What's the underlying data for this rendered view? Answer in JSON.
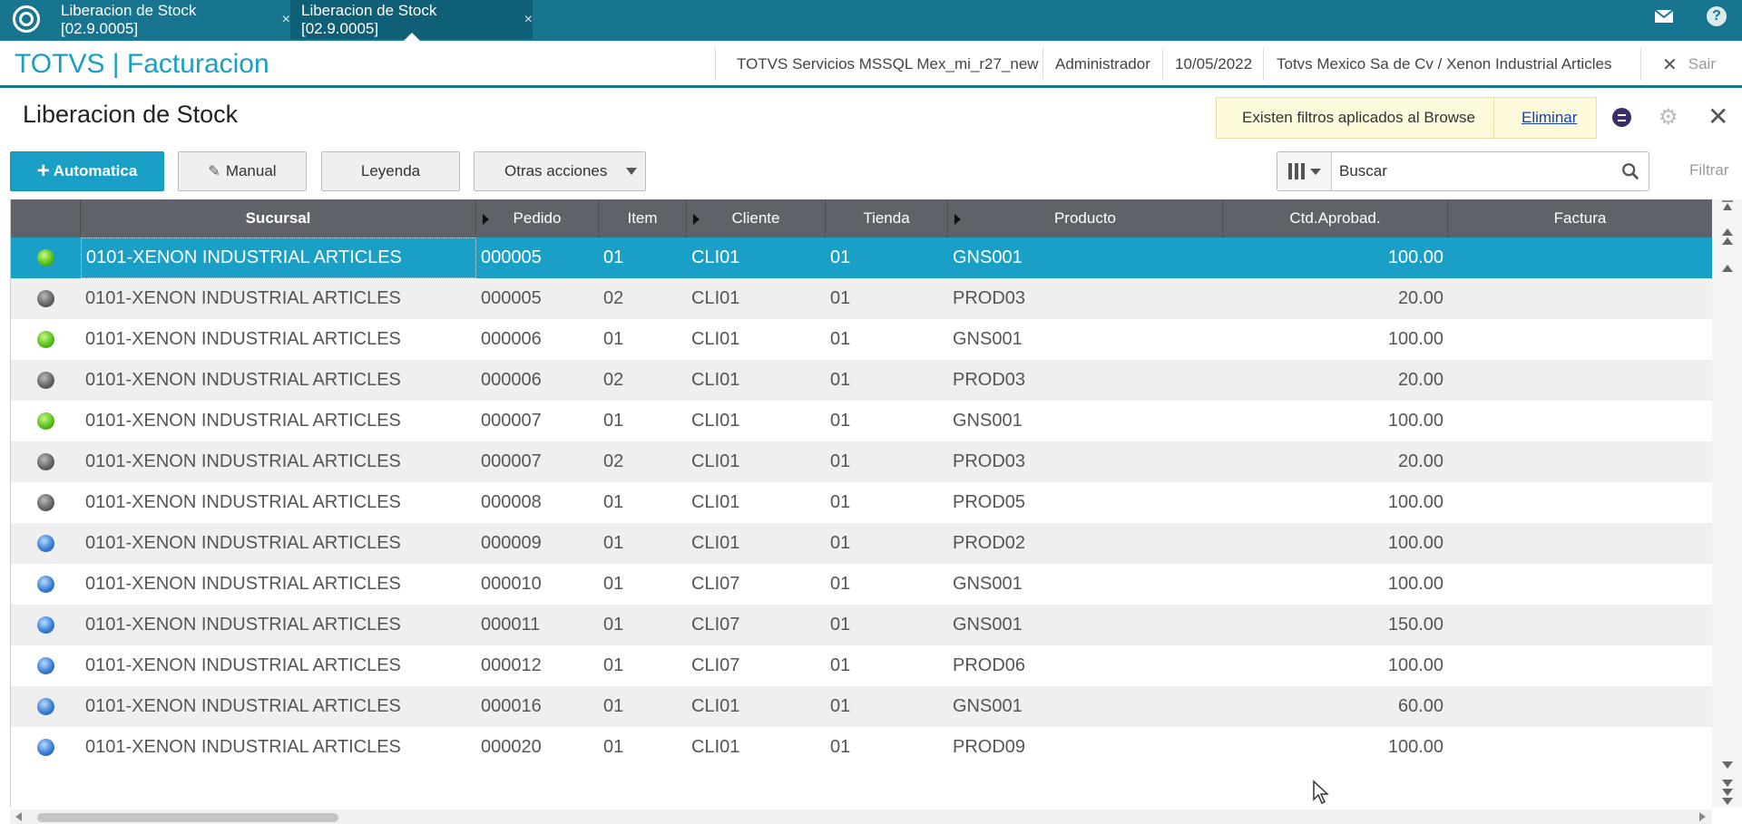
{
  "topbar": {
    "tabs": [
      {
        "label": "Liberacion de Stock [02.9.0005]",
        "close": "×"
      },
      {
        "label": "Liberacion de Stock [02.9.0005]",
        "close": "×"
      }
    ],
    "mail_icon": "mail-icon",
    "help_icon": "help-icon",
    "help_glyph": "?"
  },
  "header": {
    "app_title": "TOTVS | Facturacion",
    "environment": "TOTVS Servicios MSSQL Mex_mi_r27_new",
    "user": "Administrador",
    "date": "10/05/2022",
    "company": "Totvs Mexico Sa de Cv / Xenon Industrial Articles",
    "exit_label": "Sair"
  },
  "page": {
    "title": "Liberacion de Stock",
    "filter_notice": "Existen filtros aplicados al Browse",
    "filter_remove": "Eliminar"
  },
  "toolbar": {
    "automatica": "Automatica",
    "manual": "Manual",
    "leyenda": "Leyenda",
    "otras": "Otras acciones"
  },
  "search": {
    "placeholder": "Buscar",
    "filter_label": "Filtrar"
  },
  "grid": {
    "columns": [
      "",
      "Sucursal",
      "Pedido",
      "Item",
      "Cliente",
      "Tienda",
      "Producto",
      "Ctd.Aprobad.",
      "Factura"
    ],
    "rows": [
      {
        "status": "green",
        "sucursal": "0101-XENON INDUSTRIAL ARTICLES",
        "pedido": "000005",
        "item": "01",
        "cliente": "CLI01",
        "tienda": "01",
        "producto": "GNS001",
        "cantidad": "100.00",
        "factura": ""
      },
      {
        "status": "grey",
        "sucursal": "0101-XENON INDUSTRIAL ARTICLES",
        "pedido": "000005",
        "item": "02",
        "cliente": "CLI01",
        "tienda": "01",
        "producto": "PROD03",
        "cantidad": "20.00",
        "factura": ""
      },
      {
        "status": "green",
        "sucursal": "0101-XENON INDUSTRIAL ARTICLES",
        "pedido": "000006",
        "item": "01",
        "cliente": "CLI01",
        "tienda": "01",
        "producto": "GNS001",
        "cantidad": "100.00",
        "factura": ""
      },
      {
        "status": "grey",
        "sucursal": "0101-XENON INDUSTRIAL ARTICLES",
        "pedido": "000006",
        "item": "02",
        "cliente": "CLI01",
        "tienda": "01",
        "producto": "PROD03",
        "cantidad": "20.00",
        "factura": ""
      },
      {
        "status": "green",
        "sucursal": "0101-XENON INDUSTRIAL ARTICLES",
        "pedido": "000007",
        "item": "01",
        "cliente": "CLI01",
        "tienda": "01",
        "producto": "GNS001",
        "cantidad": "100.00",
        "factura": ""
      },
      {
        "status": "grey",
        "sucursal": "0101-XENON INDUSTRIAL ARTICLES",
        "pedido": "000007",
        "item": "02",
        "cliente": "CLI01",
        "tienda": "01",
        "producto": "PROD03",
        "cantidad": "20.00",
        "factura": ""
      },
      {
        "status": "grey",
        "sucursal": "0101-XENON INDUSTRIAL ARTICLES",
        "pedido": "000008",
        "item": "01",
        "cliente": "CLI01",
        "tienda": "01",
        "producto": "PROD05",
        "cantidad": "100.00",
        "factura": ""
      },
      {
        "status": "blue",
        "sucursal": "0101-XENON INDUSTRIAL ARTICLES",
        "pedido": "000009",
        "item": "01",
        "cliente": "CLI01",
        "tienda": "01",
        "producto": "PROD02",
        "cantidad": "100.00",
        "factura": ""
      },
      {
        "status": "blue",
        "sucursal": "0101-XENON INDUSTRIAL ARTICLES",
        "pedido": "000010",
        "item": "01",
        "cliente": "CLI07",
        "tienda": "01",
        "producto": "GNS001",
        "cantidad": "100.00",
        "factura": ""
      },
      {
        "status": "blue",
        "sucursal": "0101-XENON INDUSTRIAL ARTICLES",
        "pedido": "000011",
        "item": "01",
        "cliente": "CLI07",
        "tienda": "01",
        "producto": "GNS001",
        "cantidad": "150.00",
        "factura": ""
      },
      {
        "status": "blue",
        "sucursal": "0101-XENON INDUSTRIAL ARTICLES",
        "pedido": "000012",
        "item": "01",
        "cliente": "CLI07",
        "tienda": "01",
        "producto": "PROD06",
        "cantidad": "100.00",
        "factura": ""
      },
      {
        "status": "blue",
        "sucursal": "0101-XENON INDUSTRIAL ARTICLES",
        "pedido": "000016",
        "item": "01",
        "cliente": "CLI01",
        "tienda": "01",
        "producto": "GNS001",
        "cantidad": "60.00",
        "factura": ""
      },
      {
        "status": "blue",
        "sucursal": "0101-XENON INDUSTRIAL ARTICLES",
        "pedido": "000020",
        "item": "01",
        "cliente": "CLI01",
        "tienda": "01",
        "producto": "PROD09",
        "cantidad": "100.00",
        "factura": ""
      }
    ],
    "selected_row": 0
  },
  "colors": {
    "topbar": "#17758f",
    "accent": "#1aa0c6",
    "header_grid": "#5f6369",
    "status_green": "#58c21a",
    "status_grey": "#666666",
    "status_blue": "#3b7fd6"
  }
}
